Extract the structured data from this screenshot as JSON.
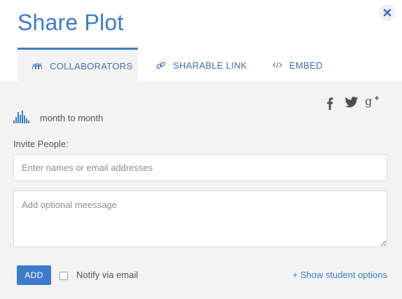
{
  "dialog": {
    "title": "Share Plot",
    "close_icon": "close-icon"
  },
  "tabs": [
    {
      "label": "COLLABORATORS",
      "icon": "people-icon",
      "active": true
    },
    {
      "label": "SHARABLE LINK",
      "icon": "link-icon",
      "active": false
    },
    {
      "label": "EMBED",
      "icon": "code-icon",
      "active": false
    }
  ],
  "social": {
    "facebook_label": "f",
    "twitter_icon": "twitter-icon",
    "gplus_label": "g+"
  },
  "plot": {
    "icon": "bar-chart-icon",
    "name": "month to month"
  },
  "invite": {
    "label": "Invite People:",
    "names_placeholder": "Enter names or email addresses",
    "names_value": "",
    "message_placeholder": "Add optional meessage",
    "message_value": ""
  },
  "actions": {
    "add_label": "ADD",
    "notify_label": "Notify via email",
    "notify_checked": false,
    "student_options_label": "+ Show student options"
  },
  "colors": {
    "accent": "#3d7cc9",
    "panel_bg": "#f3f3f3"
  }
}
